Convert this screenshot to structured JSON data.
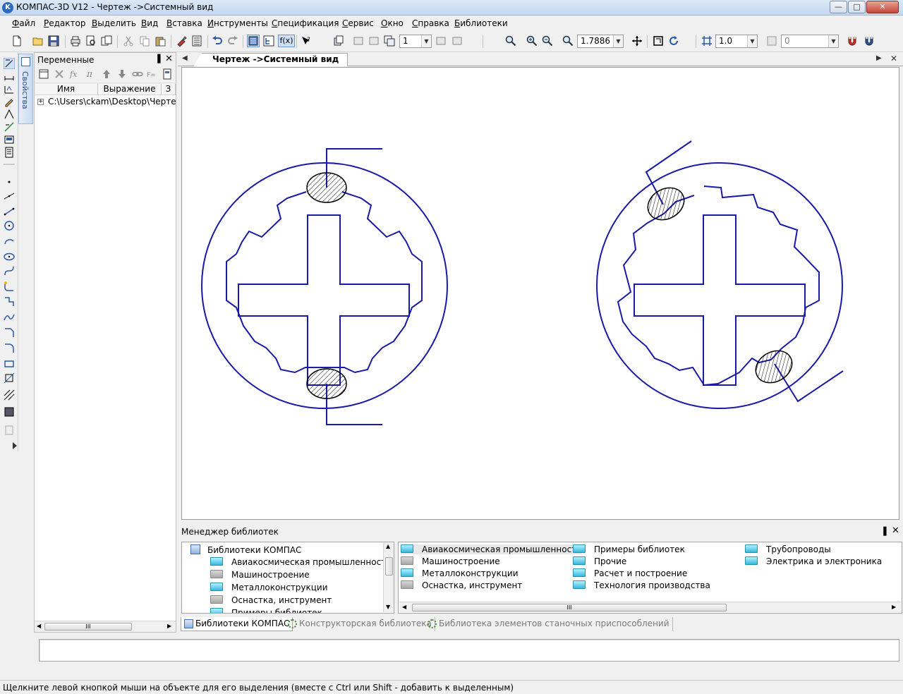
{
  "window": {
    "app_icon_letter": "K",
    "title": "КОМПАС-3D V12 - Чертеж ->Системный вид",
    "min_glyph": "—",
    "max_glyph": "□",
    "close_glyph": "✕"
  },
  "menu": {
    "items": [
      "Файл",
      "Редактор",
      "Выделить",
      "Вид",
      "Вставка",
      "Инструменты",
      "Спецификация",
      "Сервис",
      "Окно",
      "Справка",
      "Библиотеки"
    ]
  },
  "toolbar": {
    "view_number": "1",
    "zoom_value": "1.7886",
    "step_value": "1.0",
    "angle_value": "0",
    "fx_label": "f(x)"
  },
  "side_tab": {
    "label": "Свойства"
  },
  "variables_panel": {
    "title": "Переменные",
    "pin_glyph": "▐",
    "close_glyph": "✕",
    "columns": [
      "Имя",
      "Выражение",
      "З"
    ],
    "rows": [
      {
        "expand": "+",
        "path": "C:\\Users\\ckam\\Desktop\\Чертеж.cdw"
      }
    ],
    "scroll_grip": "III"
  },
  "document": {
    "tab_title": "Чертеж ->Системный вид",
    "left_arrow": "◀",
    "right_arrow": "▶",
    "close_glyph": "✕"
  },
  "library_manager": {
    "title": "Менеджер библиотек",
    "pin_glyph": "▐",
    "close_glyph": "✕",
    "tree": {
      "root": "Библиотеки КОМПАС",
      "items": [
        "Авиакосмическая промышленность",
        "Машиностроение",
        "Металлоконструкции",
        "Оснастка, инструмент",
        "Примеры библиотек"
      ]
    },
    "list": [
      {
        "label": "Авиакосмическая промышленность",
        "folder": "cyan"
      },
      {
        "label": "Машиностроение",
        "folder": "gray"
      },
      {
        "label": "Металлоконструкции",
        "folder": "cyan"
      },
      {
        "label": "Оснастка, инструмент",
        "folder": "gray"
      },
      {
        "label": "Примеры библиотек",
        "folder": "cyan"
      },
      {
        "label": "Прочие",
        "folder": "cyan"
      },
      {
        "label": "Расчет и построение",
        "folder": "cyan"
      },
      {
        "label": "Технология производства",
        "folder": "cyan"
      },
      {
        "label": "Трубопроводы",
        "folder": "cyan"
      },
      {
        "label": "Электрика и электроника",
        "folder": "cyan"
      }
    ],
    "tabs": [
      "Библиотеки КОМПАС",
      "Конструкторская библиотека",
      "Библиотека элементов станочных приспособлений"
    ],
    "scroll_grip": "III"
  },
  "status": {
    "hint": "Щелкните левой кнопкой мыши на объекте для его выделения (вместе с Ctrl или Shift - добавить к выделенным)"
  },
  "colors": {
    "drawing_line": "#1a1aa8",
    "accent": "#2a6bc4"
  }
}
